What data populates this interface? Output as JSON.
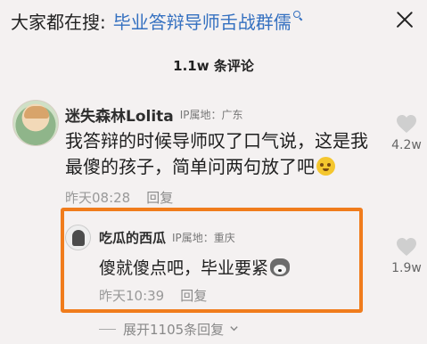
{
  "search": {
    "prefix": "大家都在搜:",
    "query": "毕业答辩导师舌战群儒"
  },
  "comments_header": {
    "count_label": "1.1w 条评论"
  },
  "main_comment": {
    "username": "迷失森林Lolita",
    "ip_location": "IP属地：广东",
    "text": "我答辩的时候导师叹了口气说，这是我最傻的孩子，简单问两句放了吧",
    "time": "昨天08:28",
    "reply_label": "回复",
    "like_count": "4.2w"
  },
  "reply_comment": {
    "username": "吃瓜的西瓜",
    "ip_location": "IP属地：重庆",
    "text": "傻就傻点吧，毕业要紧",
    "time": "昨天10:39",
    "reply_label": "回复",
    "like_count": "1.9w"
  },
  "expand": {
    "label": "展开1105条回复"
  },
  "colors": {
    "link_blue": "#3470c0",
    "highlight_orange": "#f07c1c",
    "background": "#f4f1f1"
  }
}
